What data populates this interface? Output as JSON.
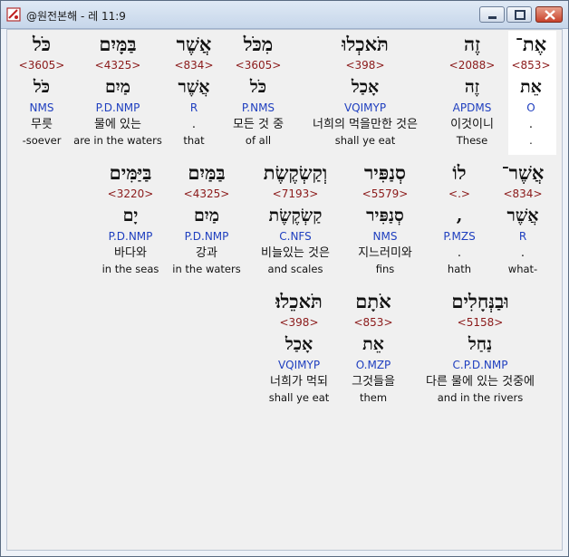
{
  "window": {
    "title": "@원전본해 - 레 11:9"
  },
  "rows": [
    [
      {
        "heb": "אֶת־",
        "strong": "<853>",
        "lemma": "אֵת",
        "parse": "O",
        "kor": ".",
        "eng": "."
      },
      {
        "heb": "זֶה",
        "strong": "<2088>",
        "lemma": "זֶה",
        "parse": "APDMS",
        "kor": "이것이니",
        "eng": "These"
      },
      {
        "heb": "תֹּאכְלוּ",
        "strong": "<398>",
        "lemma": "אָכַל",
        "parse": "VQIMYP",
        "kor": "너희의 먹을만한 것은",
        "eng": "shall ye eat"
      },
      {
        "heb": "מִכֹּל",
        "strong": "<3605>",
        "lemma": "כֹּל",
        "parse": "P.NMS",
        "kor": "모든 것 중",
        "eng": "of all"
      },
      {
        "heb": "אֲשֶׁר",
        "strong": "<834>",
        "lemma": "אֲשֶׁר",
        "parse": "R",
        "kor": ".",
        "eng": "that"
      },
      {
        "heb": "בַּמָּיִם",
        "strong": "<4325>",
        "lemma": "מַיִם",
        "parse": "P.D.NMP",
        "kor": "물에 있는",
        "eng": "are in the waters"
      },
      {
        "heb": "כֹּל",
        "strong": "<3605>",
        "lemma": "כֹּל",
        "parse": "NMS",
        "kor": "무릇",
        "eng": "-soever"
      }
    ],
    [
      {
        "heb": "אֲשֶׁר־",
        "strong": "<834>",
        "lemma": "אֲשֶׁר",
        "parse": "R",
        "kor": ".",
        "eng": "what-"
      },
      {
        "heb": "לוֹ",
        "strong": "<.>",
        "lemma": ",",
        "parse": "P.MZS",
        "kor": ".",
        "eng": "hath"
      },
      {
        "heb": "סְנַפִּיר",
        "strong": "<5579>",
        "lemma": "סְנַפִּיר",
        "parse": "NMS",
        "kor": "지느러미와",
        "eng": "fins"
      },
      {
        "heb": "וְקַשְׂקֶשֶׂת",
        "strong": "<7193>",
        "lemma": "קַשְׂקֶשֶׂת",
        "parse": "C.NFS",
        "kor": "비늘있는 것은",
        "eng": "and scales"
      },
      {
        "heb": "בַּמַּיִם",
        "strong": "<4325>",
        "lemma": "מַיִם",
        "parse": "P.D.NMP",
        "kor": "강과",
        "eng": "in the waters"
      },
      {
        "heb": "בַּיַּמִּים",
        "strong": "<3220>",
        "lemma": "יָם",
        "parse": "P.D.NMP",
        "kor": "바다와",
        "eng": "in the seas"
      }
    ],
    [
      {
        "heb": "וּבַנְּחָלִים",
        "strong": "<5158>",
        "lemma": "נַחַל",
        "parse": "C.P.D.NMP",
        "kor": "다른 물에 있는 것중에",
        "eng": "and in the rivers"
      },
      {
        "heb": "אֹתָם",
        "strong": "<853>",
        "lemma": "אֵת",
        "parse": "O.MZP",
        "kor": "그것들을",
        "eng": "them"
      },
      {
        "heb": "תֹּאכֵלוּ׃",
        "strong": "<398>",
        "lemma": "אָכַל",
        "parse": "VQIMYP",
        "kor": "너희가 먹되",
        "eng": "shall ye eat"
      }
    ]
  ]
}
